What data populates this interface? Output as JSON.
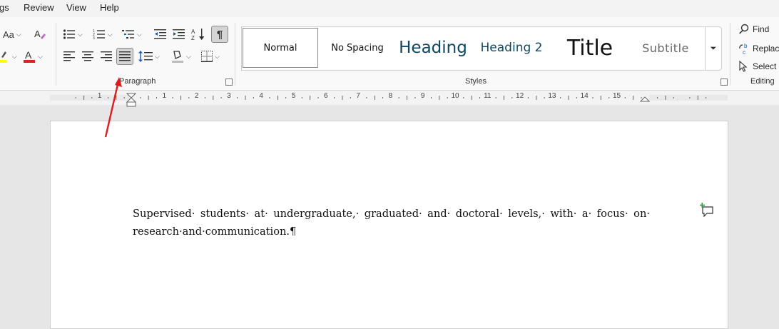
{
  "menu": {
    "item_1": "gs",
    "item_2": "Review",
    "item_3": "View",
    "item_4": "Help"
  },
  "font_group": {
    "change_case": "Aa"
  },
  "groups": {
    "paragraph": "Paragraph",
    "styles": "Styles",
    "editing": "Editing"
  },
  "styles": {
    "normal": "Normal",
    "no_spacing": "No Spacing",
    "heading": "Heading",
    "heading2": "Heading 2",
    "title": "Title",
    "subtitle": "Subtitle"
  },
  "editing": {
    "find": "Find",
    "replace": "Replace",
    "select": "Select"
  },
  "ruler": {
    "labels": [
      "1",
      "1",
      "2",
      "3",
      "4",
      "5",
      "6",
      "7",
      "8",
      "9",
      "10",
      "11",
      "12",
      "13",
      "14",
      "15"
    ]
  },
  "document": {
    "text": "Supervised· students· at· undergraduate,· graduated· and· doctoral· levels,· with· a· focus· on· research·and·communication.¶"
  },
  "colors": {
    "accent": "#185abd",
    "heading": "#0f4761",
    "font_color": "#e0201f",
    "highlight": "#ffff00",
    "arrow": "#e01b1b"
  },
  "icons": [
    "bullets-icon",
    "numbering-icon",
    "multilevel-list-icon",
    "decrease-indent-icon",
    "increase-indent-icon",
    "sort-icon",
    "show-marks-icon",
    "align-left-icon",
    "align-center-icon",
    "align-right-icon",
    "justify-icon",
    "line-spacing-icon",
    "shading-icon",
    "borders-icon",
    "find-icon",
    "replace-icon",
    "select-icon",
    "new-comment-icon"
  ]
}
